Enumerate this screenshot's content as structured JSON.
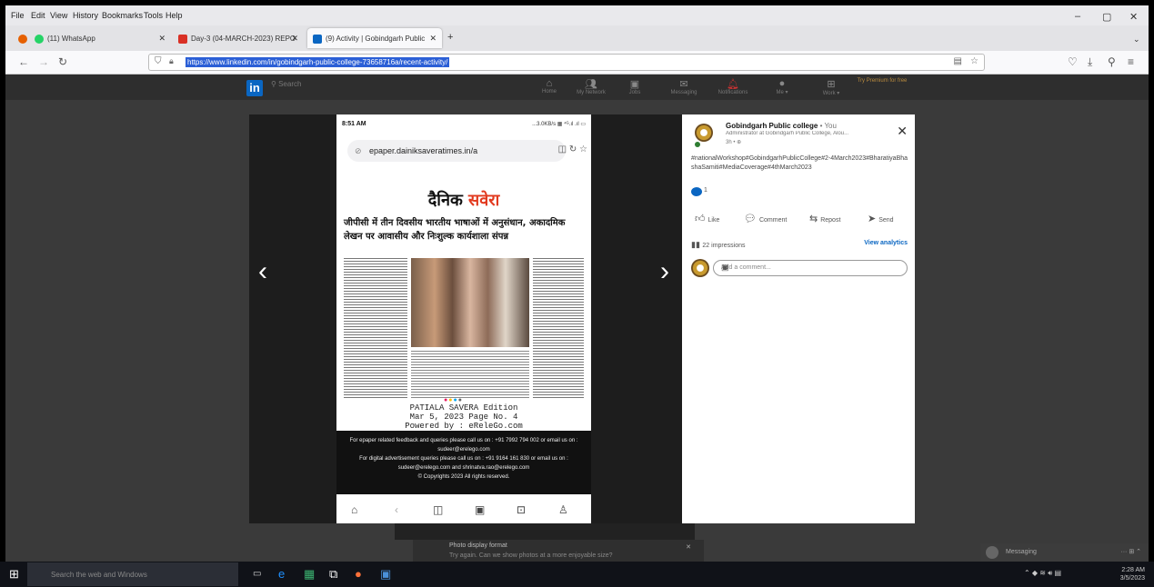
{
  "browser": {
    "menu": [
      "File",
      "Edit",
      "View",
      "History",
      "Bookmarks",
      "Tools",
      "Help"
    ],
    "window_controls": [
      "–",
      "▢",
      "✕"
    ],
    "tabs": [
      {
        "label": "(11) WhatsApp",
        "favicon_color": "#25d366",
        "icon": "whatsapp-icon"
      },
      {
        "label": "Day-3 (04-MARCH-2023) REPO",
        "favicon_color": "#d93025",
        "icon": "gmail-icon"
      },
      {
        "label": "(9) Activity | Gobindgarh Public",
        "favicon_color": "#0a66c2",
        "icon": "linkedin-icon"
      }
    ],
    "new_tab": "+",
    "url": "https://www.linkedin.com/in/gobindgarh-public-college-73658716a/recent-activity/"
  },
  "linkedin": {
    "logo": "in",
    "search_placeholder": "Search",
    "nav": [
      "Home",
      "My Network",
      "Jobs",
      "Messaging",
      "Notifications",
      "Me ▾",
      "Work ▾",
      "Try Premium for free"
    ]
  },
  "post_image": {
    "time": "8:51 AM",
    "status": "...3.0KB/s ▦ ⁴ᴳ.ıl .ıl ▭",
    "url_text": "epaper.dainiksaveratimes.in/a",
    "masthead_a": "दैनिक ",
    "masthead_b": "सवेरा",
    "headline": "जीपीसी में तीन दिवसीय भारतीय भाषाओं में अनुसंधान, अकादमिक लेखन पर आवासीय और निःशुल्क कार्यशाला संपन्न",
    "edition_line1": "PATIALA SAVERA Edition",
    "edition_line2": "Mar 5, 2023 Page No. 4",
    "edition_line3": "Powered by : eReleGo.com",
    "footer_line1": "For epaper related feedback and queries please call us on : +91 7992 794 002 or email us on : sudeer@erelego.com",
    "footer_line2": "For digital advertisement queries please call us on : +91 9164 161 830 or email us on : sudeer@erelego.com and shrinatva.rao@erelego.com",
    "footer_line3": "© Copyrights 2023 All rights reserved."
  },
  "post": {
    "author": "Gobindgarh Public college",
    "author_suffix": " • You",
    "subtitle": "Administrator at Gobindgarh Public College, Alou...",
    "time": "3h • ⊕",
    "text": "#nationalWorkshop#GobindgarhPublicCollege#2-4March2023#BharatiyaBhashaSamiti#MediaCoverage#4thMarch2023",
    "reaction_count": "1",
    "actions": [
      "Like",
      "Comment",
      "Repost",
      "Send"
    ],
    "impressions": "22 impressions",
    "view_analytics": "View analytics",
    "comment_placeholder": "Add a comment..."
  },
  "background": {
    "toast_title": "Photo display format",
    "toast_text": "Try again. Can we show photos at a more enjoyable size?",
    "messaging": "Messaging"
  },
  "taskbar": {
    "search_placeholder": "Search the web and Windows",
    "time": "2:28 AM",
    "date": "3/5/2023"
  }
}
